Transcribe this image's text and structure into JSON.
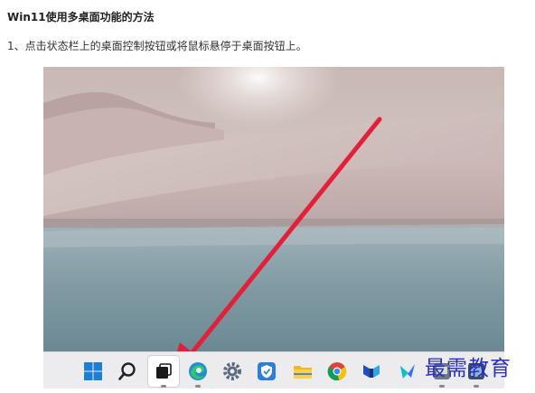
{
  "article": {
    "title": "Win11使用多桌面功能的方法",
    "step1": "1、点击状态栏上的桌面控制按钮或将鼠标悬停于桌面按钮上。"
  },
  "watermark": {
    "text": "最需教育"
  },
  "taskbar": {
    "items": [
      {
        "name": "start-icon",
        "dot": false
      },
      {
        "name": "search-icon",
        "dot": false
      },
      {
        "name": "task-view-icon",
        "dot": true,
        "highlighted": true
      },
      {
        "name": "edge-icon",
        "dot": true
      },
      {
        "name": "settings-icon",
        "dot": false
      },
      {
        "name": "security-icon",
        "dot": false
      },
      {
        "name": "file-explorer-icon",
        "dot": false
      },
      {
        "name": "chrome-icon",
        "dot": false
      },
      {
        "name": "app-icon",
        "dot": false
      },
      {
        "name": "feishu-icon",
        "dot": false
      },
      {
        "name": "app-icon-2",
        "dot": true
      },
      {
        "name": "app-icon-3",
        "dot": true
      }
    ]
  },
  "colors": {
    "arrow": "#e2203a",
    "watermark": "#2a2fbf",
    "taskbar": "#ecebee"
  }
}
